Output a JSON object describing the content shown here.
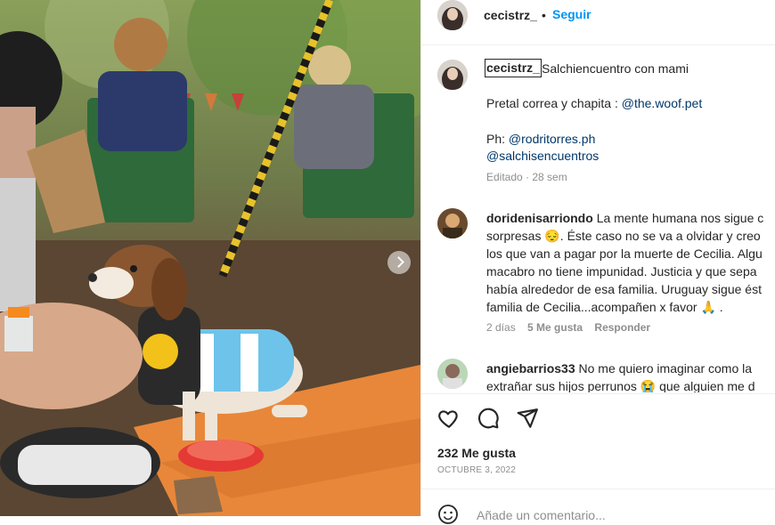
{
  "post": {
    "username": "cecistrz_",
    "dot": "•",
    "follow_label": "Seguir"
  },
  "caption": {
    "username": "cecistrz_",
    "title": "Salchiencuentro con mami",
    "line1_prefix": "Pretal correa y chapita : ",
    "line1_link": "@the.woof.pet",
    "line2_prefix": "Ph: ",
    "line2_link": "@rodritorres.ph",
    "line3_link": "@salchisencuentros",
    "meta": "Editado · 28 sem"
  },
  "comments": [
    {
      "username": "doridenisarriondo",
      "lines": [
        "La mente humana nos sigue c",
        "sorpresas 😔. Éste caso no se va a olvidar y creo",
        "los que van a pagar por la muerte de Cecilia. Algu",
        "macabro no tiene impunidad. Justicia y que sepa",
        "había alrededor de esa familia. Uruguay sigue ést",
        "familia de Cecilia...acompañen x favor 🙏 ."
      ],
      "time": "2 días",
      "likes": "5 Me gusta",
      "reply": "Responder"
    },
    {
      "username": "angiebarrios33",
      "lines": [
        "No me quiero imaginar como la",
        "extrañar sus hijos perrunos 😭 que alguien me d"
      ]
    }
  ],
  "actions": {
    "likes": "232 Me gusta",
    "date": "OCTUBRE 3, 2022",
    "comment_placeholder": "Añade un comentario..."
  },
  "icons": {
    "like": "heart-icon",
    "comment": "comment-icon",
    "share": "paper-plane-icon",
    "emoji": "smiley-icon",
    "next": "chevron-right-icon"
  },
  "colors": {
    "follow": "#0095f6",
    "link": "#00376b",
    "muted": "#8e8e8e"
  }
}
